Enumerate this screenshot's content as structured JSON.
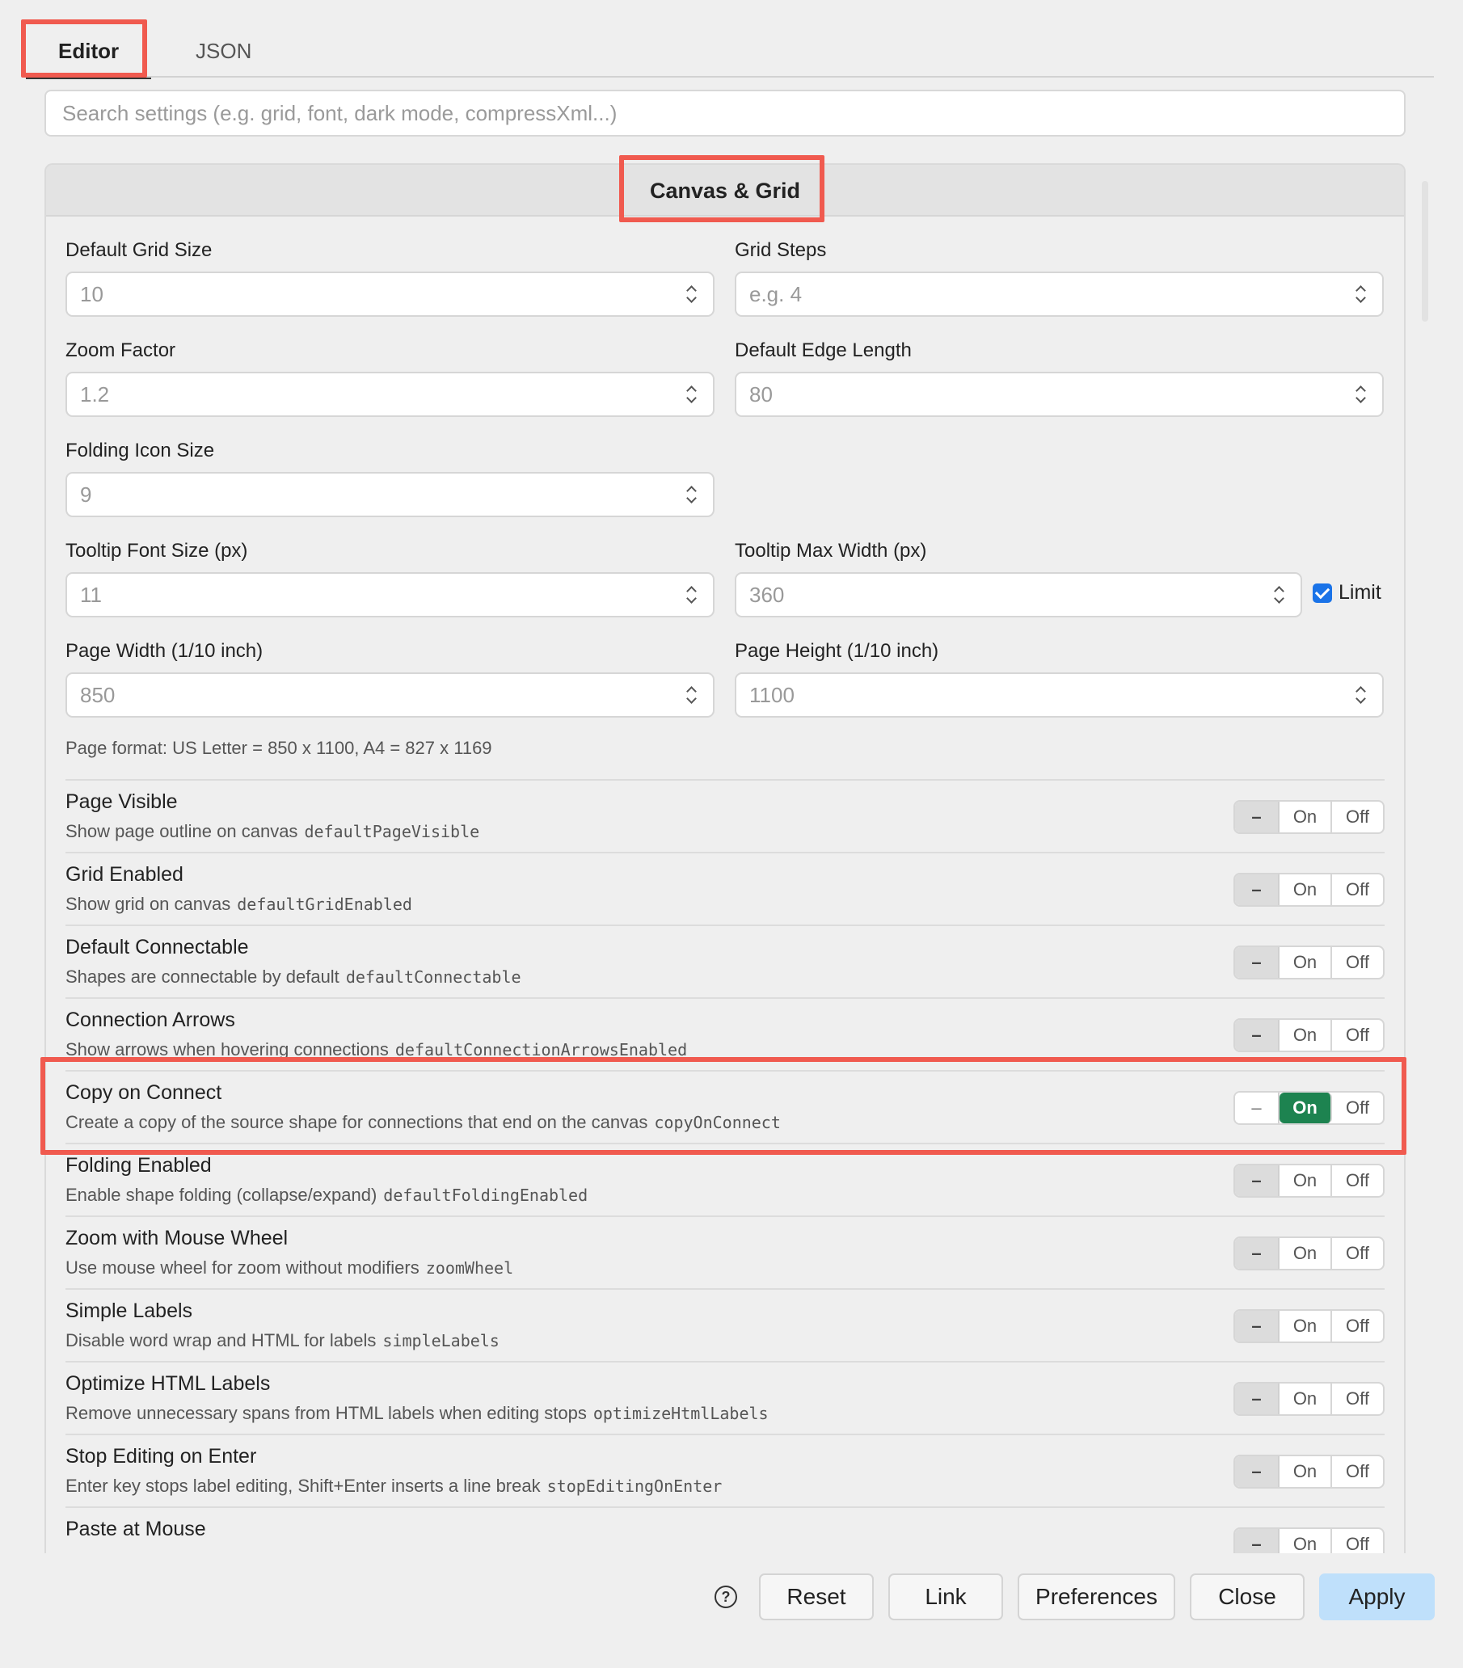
{
  "tabs": [
    {
      "label": "Editor",
      "active": true
    },
    {
      "label": "JSON",
      "active": false
    }
  ],
  "search": {
    "placeholder": "Search settings (e.g. grid, font, dark mode, compressXml...)"
  },
  "section": {
    "title": "Canvas & Grid"
  },
  "fields": {
    "default_grid_size": {
      "label": "Default Grid Size",
      "value": "10"
    },
    "grid_steps": {
      "label": "Grid Steps",
      "placeholder": "e.g. 4"
    },
    "zoom_factor": {
      "label": "Zoom Factor",
      "value": "1.2"
    },
    "default_edge_length": {
      "label": "Default Edge Length",
      "value": "80"
    },
    "folding_icon_size": {
      "label": "Folding Icon Size",
      "value": "9"
    },
    "tooltip_font_size": {
      "label": "Tooltip Font Size (px)",
      "value": "11"
    },
    "tooltip_max_width": {
      "label": "Tooltip Max Width (px)",
      "value": "360"
    },
    "limit": {
      "label": "Limit",
      "checked": true
    },
    "page_width": {
      "label": "Page Width (1/10 inch)",
      "value": "850"
    },
    "page_height": {
      "label": "Page Height (1/10 inch)",
      "value": "1100"
    }
  },
  "page_note": "Page format: US Letter = 850 x 1100, A4 = 827 x 1169",
  "options": [
    {
      "title": "Page Visible",
      "desc": "Show page outline on canvas",
      "key": "defaultPageVisible",
      "state": "default"
    },
    {
      "title": "Grid Enabled",
      "desc": "Show grid on canvas",
      "key": "defaultGridEnabled",
      "state": "default"
    },
    {
      "title": "Default Connectable",
      "desc": "Shapes are connectable by default",
      "key": "defaultConnectable",
      "state": "default"
    },
    {
      "title": "Connection Arrows",
      "desc": "Show arrows when hovering connections",
      "key": "defaultConnectionArrowsEnabled",
      "state": "default"
    },
    {
      "title": "Copy on Connect",
      "desc": "Create a copy of the source shape for connections that end on the canvas",
      "key": "copyOnConnect",
      "state": "on"
    },
    {
      "title": "Folding Enabled",
      "desc": "Enable shape folding (collapse/expand)",
      "key": "defaultFoldingEnabled",
      "state": "default"
    },
    {
      "title": "Zoom with Mouse Wheel",
      "desc": "Use mouse wheel for zoom without modifiers",
      "key": "zoomWheel",
      "state": "default"
    },
    {
      "title": "Simple Labels",
      "desc": "Disable word wrap and HTML for labels",
      "key": "simpleLabels",
      "state": "default"
    },
    {
      "title": "Optimize HTML Labels",
      "desc": "Remove unnecessary spans from HTML labels when editing stops",
      "key": "optimizeHtmlLabels",
      "state": "default"
    },
    {
      "title": "Stop Editing on Enter",
      "desc": "Enter key stops label editing, Shift+Enter inserts a line break",
      "key": "stopEditingOnEnter",
      "state": "default"
    },
    {
      "title": "Paste at Mouse",
      "desc": "",
      "key": "",
      "state": "default"
    }
  ],
  "toggle_labels": {
    "dash": "–",
    "on": "On",
    "off": "Off"
  },
  "footer": {
    "help": "?",
    "reset": "Reset",
    "link": "Link",
    "preferences": "Preferences",
    "close": "Close",
    "apply": "Apply"
  },
  "colors": {
    "highlight": "#f05a4f",
    "on_active": "#1d8350",
    "apply_bg": "#bfe0fb",
    "check": "#1a73e8"
  }
}
